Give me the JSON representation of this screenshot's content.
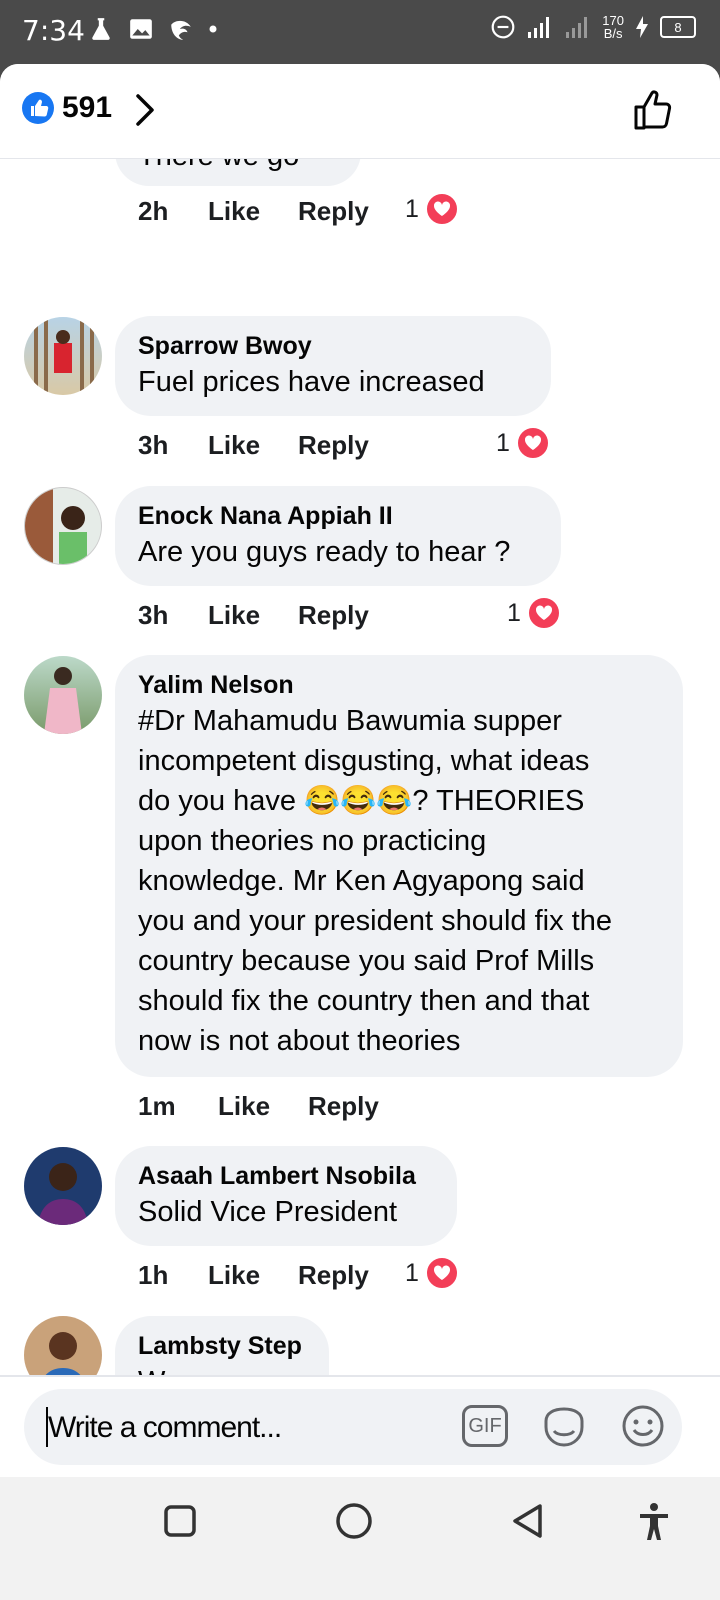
{
  "status_bar": {
    "time": "7:34",
    "network_speed_top": "170",
    "network_speed_bottom": "B/s",
    "battery": "8"
  },
  "header": {
    "like_count": "591"
  },
  "comments": [
    {
      "author": "",
      "text": "There we go",
      "time": "2h",
      "like": "Like",
      "reply": "Reply",
      "reactions": "1"
    },
    {
      "author": "Sparrow Bwoy",
      "text": "Fuel prices have increased",
      "time": "3h",
      "like": "Like",
      "reply": "Reply",
      "reactions": "1"
    },
    {
      "author": "Enock Nana Appiah II",
      "text": "Are you guys ready to hear ?",
      "time": "3h",
      "like": "Like",
      "reply": "Reply",
      "reactions": "1"
    },
    {
      "author": "Yalim Nelson",
      "text_lines": [
        "#Dr Mahamudu Bawumia supper",
        "incompetent disgusting, what ideas",
        "do you have 😂😂😂? THEORIES",
        "upon theories no practicing",
        "knowledge. Mr Ken Agyapong said",
        "you and your president should fix the",
        "country because you said Prof Mills",
        "should fix the country then and that",
        "now is not about theories"
      ],
      "time": "1m",
      "like": "Like",
      "reply": "Reply"
    },
    {
      "author": "Asaah Lambert Nsobila",
      "text": "Solid Vice President",
      "time": "1h",
      "like": "Like",
      "reply": "Reply",
      "reactions": "1"
    },
    {
      "author": "Lambsty Step",
      "text": "We move"
    }
  ],
  "composer": {
    "placeholder": "Write a comment...",
    "gif_label": "GIF"
  },
  "colors": {
    "like_blue": "#1877f2",
    "heart_red": "#f33e58",
    "bubble_gray": "#f0f2f5"
  }
}
